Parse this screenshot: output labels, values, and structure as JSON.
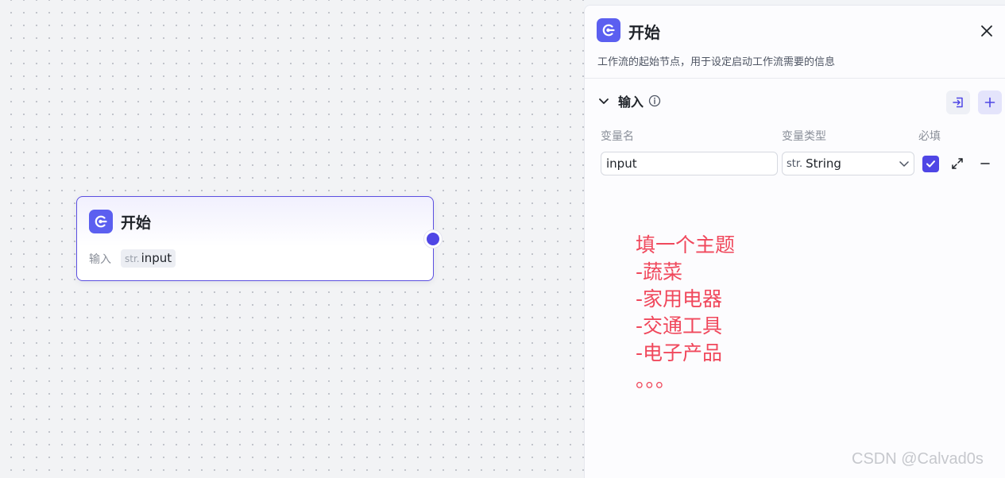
{
  "node": {
    "title": "开始",
    "input_label": "输入",
    "var_type": "str.",
    "var_name": "input"
  },
  "panel": {
    "title": "开始",
    "description": "工作流的起始节点，用于设定启动工作流需要的信息",
    "section_title": "输入",
    "columns": {
      "name": "变量名",
      "type": "变量类型",
      "required": "必填"
    },
    "row": {
      "name_value": "input",
      "type_prefix": "str.",
      "type_value": "String",
      "required": true
    }
  },
  "annotation": {
    "lines": [
      "填一个主题",
      "-蔬菜",
      "-家用电器",
      "-交通工具",
      "-电子产品",
      "。。。"
    ]
  },
  "watermark": "CSDN @Calvad0s",
  "icons": {
    "node_icon": "start-icon",
    "close": "close-icon",
    "collapse": "chevron-down-icon",
    "info": "info-icon",
    "import": "import-icon",
    "add": "plus-icon",
    "dropdown": "chevron-down-icon",
    "check": "check-icon",
    "expand": "expand-icon",
    "remove": "minus-icon"
  },
  "colors": {
    "accent": "#4f46e5",
    "annotation": "#f0485c"
  }
}
